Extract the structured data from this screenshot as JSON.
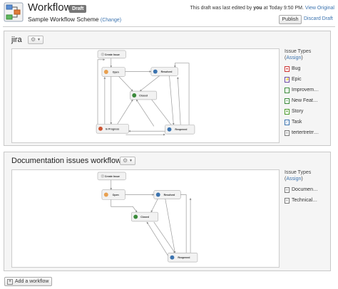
{
  "header": {
    "app_icon": "workflow-diagram-icon",
    "title": "Workflows",
    "badge": "Draft",
    "scheme_name": "Sample Workflow Scheme",
    "change_label": "(Change)",
    "status_prefix": "This draft was last edited by",
    "status_user": "you",
    "status_time": "at Today 9:50 PM.",
    "view_original_label": "View Original",
    "publish_label": "Publish",
    "discard_label": "Discard Draft"
  },
  "workflows": [
    {
      "name": "jira",
      "gear_icon": "gear-icon",
      "issue_types_heading": "Issue Types",
      "assign_label": "Assign",
      "issue_types": [
        {
          "name": "Bug",
          "icon": "bug-icon",
          "color": "#cc3333"
        },
        {
          "name": "Epic",
          "icon": "epic-icon",
          "color": "#6b4ba3"
        },
        {
          "name": "Improvem…",
          "icon": "improvement-icon",
          "color": "#3a8a3a"
        },
        {
          "name": "New Feat…",
          "icon": "new-feature-icon",
          "color": "#3a8a3a"
        },
        {
          "name": "Story",
          "icon": "story-icon",
          "color": "#4a9a2a"
        },
        {
          "name": "Task",
          "icon": "task-icon",
          "color": "#3b73af"
        },
        {
          "name": "tertertretrr…",
          "icon": "generic-issue-icon",
          "color": "#777777"
        }
      ],
      "diagram_nodes": {
        "create": "Create Issue",
        "open": "Open",
        "resolved": "Resolved",
        "closed": "Closed",
        "in_progress": "In Progress",
        "reopened": "Reopened"
      }
    },
    {
      "name": "Documentation issues workflow",
      "gear_icon": "gear-icon",
      "issue_types_heading": "Issue Types",
      "assign_label": "Assign",
      "issue_types": [
        {
          "name": "Documen…",
          "icon": "documentation-icon",
          "color": "#777777"
        },
        {
          "name": "Technical…",
          "icon": "technical-task-icon",
          "color": "#777777"
        }
      ],
      "diagram_nodes": {
        "create": "Create Issue",
        "open": "Open",
        "resolved": "Resolved",
        "closed": "Closed",
        "reopened": "Reopened"
      }
    }
  ],
  "footer": {
    "add_workflow_label": "Add a workflow",
    "add_icon": "plus-icon"
  }
}
